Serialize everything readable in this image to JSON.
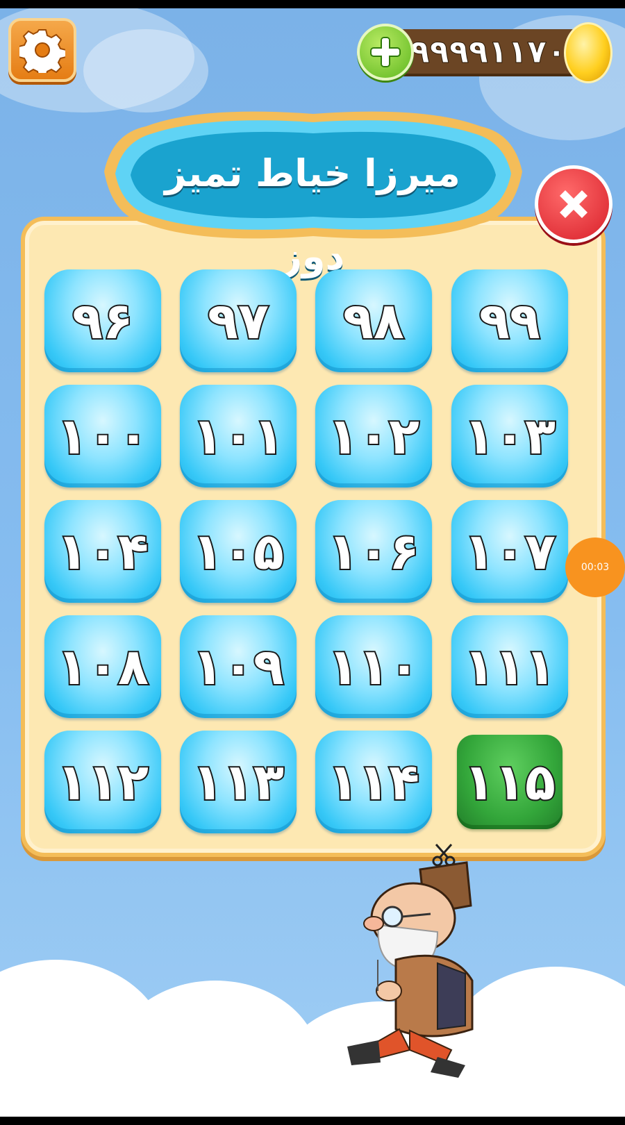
{
  "header": {
    "coins": "۹۹۹۹۱۱۷۰",
    "add_coins_icon": "plus-icon",
    "coin_icon": "gold-coin-icon",
    "settings_icon": "gear-icon"
  },
  "title": "میرزا خیاط تمیز دوز",
  "close_icon": "close-icon",
  "levels": [
    {
      "label": "۹۶"
    },
    {
      "label": "۹۷"
    },
    {
      "label": "۹۸"
    },
    {
      "label": "۹۹"
    },
    {
      "label": "۱۰۰"
    },
    {
      "label": "۱۰۱"
    },
    {
      "label": "۱۰۲"
    },
    {
      "label": "۱۰۳"
    },
    {
      "label": "۱۰۴"
    },
    {
      "label": "۱۰۵"
    },
    {
      "label": "۱۰۶"
    },
    {
      "label": "۱۰۷"
    },
    {
      "label": "۱۰۸"
    },
    {
      "label": "۱۰۹"
    },
    {
      "label": "۱۱۰"
    },
    {
      "label": "۱۱۱"
    },
    {
      "label": "۱۱۲"
    },
    {
      "label": "۱۱۳"
    },
    {
      "label": "۱۱۴"
    },
    {
      "label": "۱۱۵",
      "current": true
    }
  ],
  "timer": "00:03",
  "colors": {
    "sky": "#86bdf0",
    "board": "#fde8b2",
    "level_button": "#36c8f7",
    "current_level": "#33a63a",
    "close": "#d8202a",
    "settings": "#e57d14"
  }
}
